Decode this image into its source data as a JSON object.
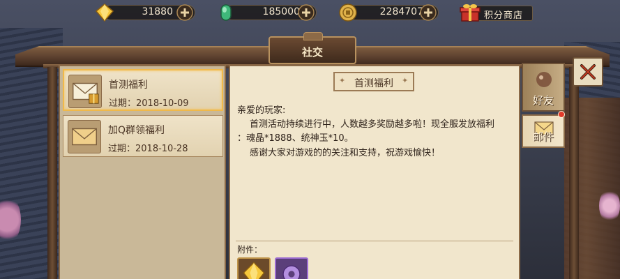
{
  "resources": {
    "gems": "31880",
    "jade": "185000",
    "coins": "2284707",
    "shop_label": "积分商店"
  },
  "panel": {
    "title": "社交"
  },
  "mail_list": [
    {
      "title": "首测福利",
      "expiry": "过期：2018-10-09"
    },
    {
      "title": "加Q群领福利",
      "expiry": "过期：2018-10-28"
    }
  ],
  "mail_content": {
    "title": "首测福利",
    "greeting": "亲爱的玩家:",
    "lines": [
      "首测活动持续进行中，人数越多奖励越多啦！现全服发放福利",
      "：魂晶*1888、统神玉*10。",
      "感谢大家对游戏的的关注和支持，祝游戏愉快！"
    ],
    "attachments_label": "附件："
  },
  "tabs": {
    "friends": "好友",
    "mail": "邮件"
  },
  "colors": {
    "accent_gold": "#f0b94a",
    "badge_red": "#e23a2a"
  },
  "icons": [
    "gem-icon",
    "jade-icon",
    "coin-icon",
    "plus-icon",
    "gift-box-icon",
    "envelope-icon",
    "close-icon"
  ]
}
